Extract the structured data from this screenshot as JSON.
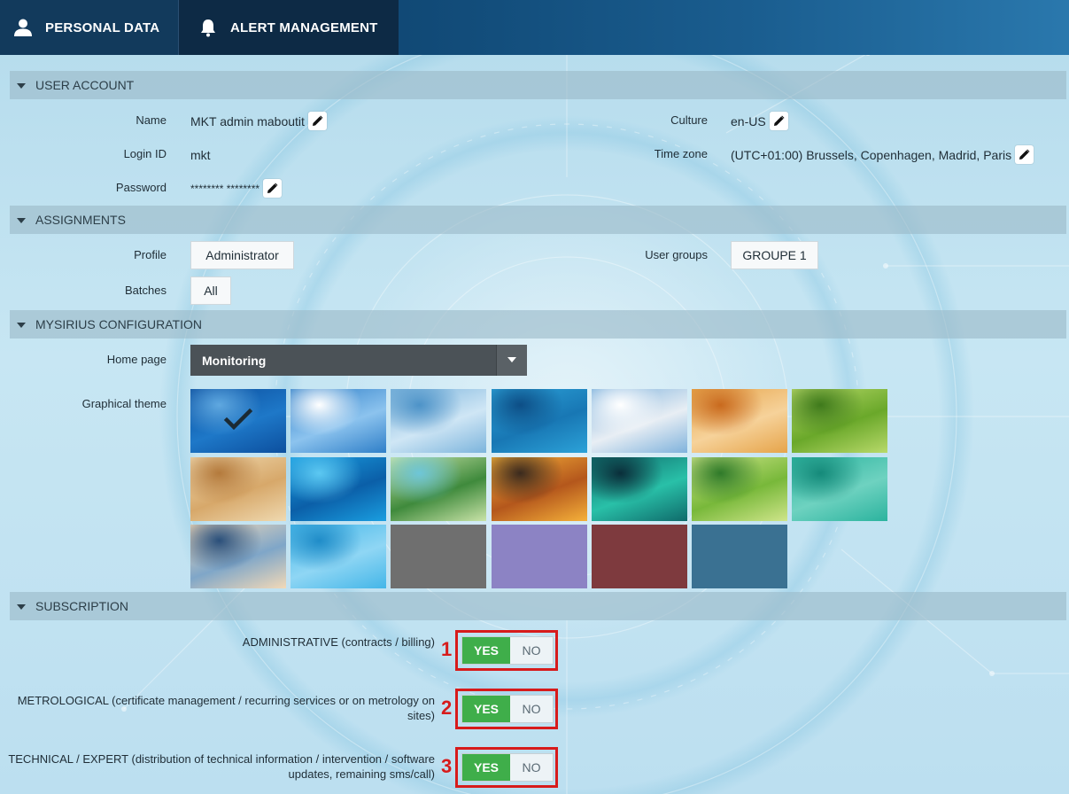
{
  "tabs": [
    {
      "label": "PERSONAL DATA",
      "icon": "user-icon"
    },
    {
      "label": "ALERT MANAGEMENT",
      "icon": "bell-icon"
    }
  ],
  "user_account": {
    "title": "USER ACCOUNT",
    "name_label": "Name",
    "name_value": "MKT admin maboutit",
    "login_label": "Login ID",
    "login_value": "mkt",
    "password_label": "Password",
    "password_value": "******** ********",
    "culture_label": "Culture",
    "culture_value": "en-US",
    "timezone_label": "Time zone",
    "timezone_value": "(UTC+01:00) Brussels, Copenhagen, Madrid, Paris"
  },
  "assignments": {
    "title": "ASSIGNMENTS",
    "profile_label": "Profile",
    "profile_value": "Administrator",
    "batches_label": "Batches",
    "batches_value": "All",
    "usergroups_label": "User groups",
    "usergroups_value": "GROUPE 1"
  },
  "configuration": {
    "title": "MYSIRIUS CONFIGURATION",
    "homepage_label": "Home page",
    "homepage_value": "Monitoring",
    "theme_label": "Graphical theme",
    "themes": [
      {
        "name": "blue-tech",
        "selected": true,
        "colors": [
          "#0c4f9e",
          "#1e78c8",
          "#5fa8e0"
        ]
      },
      {
        "name": "sky-sun",
        "selected": false,
        "colors": [
          "#2f7fc8",
          "#8cc3ee",
          "#ffffff"
        ]
      },
      {
        "name": "frost",
        "selected": false,
        "colors": [
          "#7cb4dc",
          "#cfe6f5",
          "#4d93c8"
        ]
      },
      {
        "name": "underwater",
        "selected": false,
        "colors": [
          "#2ca2d8",
          "#1877b4",
          "#0d4e86"
        ]
      },
      {
        "name": "snow-forest",
        "selected": false,
        "colors": [
          "#7fb2dc",
          "#e8eef4",
          "#ffffff"
        ]
      },
      {
        "name": "autumn-leaves",
        "selected": false,
        "colors": [
          "#e6a44a",
          "#f6d29a",
          "#c96a1e"
        ]
      },
      {
        "name": "grass",
        "selected": false,
        "colors": [
          "#b8d96a",
          "#6aa82a",
          "#3f7a1c"
        ]
      },
      {
        "name": "desert",
        "selected": false,
        "colors": [
          "#efd9b0",
          "#d7a86a",
          "#b47a3c"
        ]
      },
      {
        "name": "blue-network",
        "selected": false,
        "colors": [
          "#1a9ee0",
          "#0b5fa8",
          "#5cc8f2"
        ]
      },
      {
        "name": "green-lake",
        "selected": false,
        "colors": [
          "#c9e3a8",
          "#3f8a3c",
          "#6ec6d8"
        ]
      },
      {
        "name": "sunset-hills",
        "selected": false,
        "colors": [
          "#f5b13a",
          "#b4571c",
          "#3a2a1e"
        ]
      },
      {
        "name": "aurora",
        "selected": false,
        "colors": [
          "#0f6a6a",
          "#29c0a8",
          "#0a2e3a"
        ]
      },
      {
        "name": "sprout",
        "selected": false,
        "colors": [
          "#cfe58a",
          "#78b83a",
          "#2f7a2a"
        ]
      },
      {
        "name": "dew-leaf",
        "selected": false,
        "colors": [
          "#2bb39e",
          "#6ed2c0",
          "#158a7a"
        ]
      },
      {
        "name": "misty-mountains",
        "selected": false,
        "colors": [
          "#f2d9b8",
          "#7fa6c8",
          "#2a4f7a"
        ]
      },
      {
        "name": "water-drops",
        "selected": false,
        "colors": [
          "#44b6e8",
          "#8fd6f4",
          "#1f8cc8"
        ]
      },
      {
        "name": "grey",
        "selected": false,
        "colors": [
          "#6f6f6f"
        ]
      },
      {
        "name": "lavender",
        "selected": false,
        "colors": [
          "#8c83c4"
        ]
      },
      {
        "name": "burgundy",
        "selected": false,
        "colors": [
          "#7e3a3e"
        ]
      },
      {
        "name": "steel-blue",
        "selected": false,
        "colors": [
          "#3a7192"
        ]
      }
    ]
  },
  "subscription": {
    "title": "SUBSCRIPTION",
    "items": [
      {
        "number": "1",
        "label": "ADMINISTRATIVE (contracts / billing)",
        "yes": "YES",
        "no": "NO"
      },
      {
        "number": "2",
        "label": "METROLOGICAL (certificate management / recurring services or on metrology on sites)",
        "yes": "YES",
        "no": "NO"
      },
      {
        "number": "3",
        "label_line1": "TECHNICAL / EXPERT (distribution of technical information / intervention / software",
        "label_line2": "updates, remaining sms/call)",
        "yes": "YES",
        "no": "NO"
      }
    ]
  },
  "colors": {
    "accent_green": "#3fae4a",
    "highlight_red": "#d71b1b",
    "header_dark": "#0d2a45"
  }
}
